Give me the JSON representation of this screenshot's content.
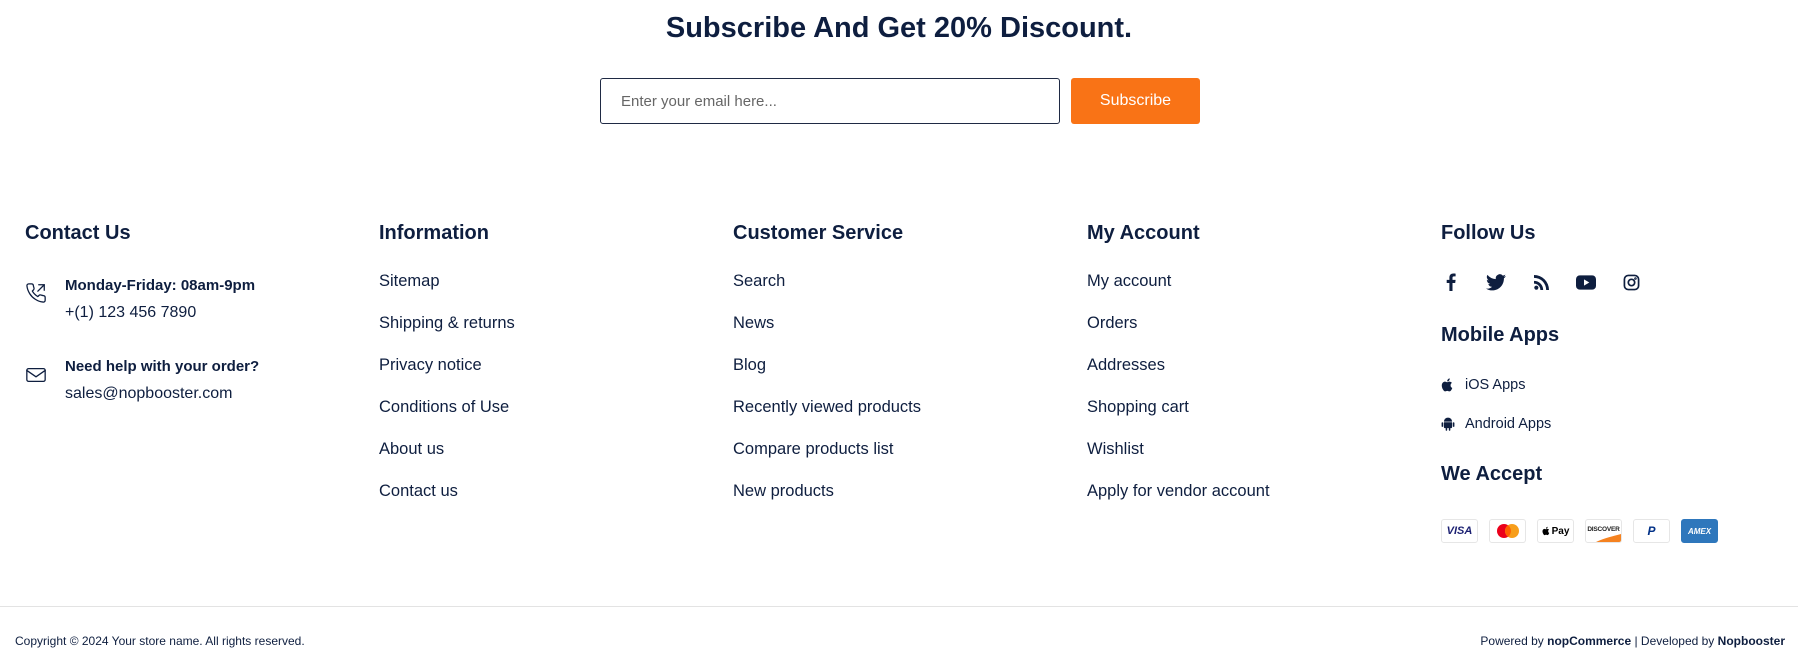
{
  "subscribe": {
    "title": "Subscribe And Get 20% Discount.",
    "placeholder": "Enter your email here...",
    "button_label": "Subscribe"
  },
  "contact": {
    "title": "Contact Us",
    "hours_label": "Monday-Friday: 08am-9pm",
    "phone": "+(1) 123 456 7890",
    "help_label": "Need help with your order?",
    "email": "sales@nopbooster.com"
  },
  "information": {
    "title": "Information",
    "links": [
      "Sitemap",
      "Shipping & returns",
      "Privacy notice",
      "Conditions of Use",
      "About us",
      "Contact us"
    ]
  },
  "customer_service": {
    "title": "Customer Service",
    "links": [
      "Search",
      "News",
      "Blog",
      "Recently viewed products",
      "Compare products list",
      "New products"
    ]
  },
  "my_account": {
    "title": "My Account",
    "links": [
      "My account",
      "Orders",
      "Addresses",
      "Shopping cart",
      "Wishlist",
      "Apply for vendor account"
    ]
  },
  "follow": {
    "title": "Follow Us",
    "icons": [
      "facebook-icon",
      "twitter-icon",
      "rss-icon",
      "youtube-icon",
      "instagram-icon"
    ],
    "mobile_title": "Mobile Apps",
    "ios_label": "iOS Apps",
    "android_label": "Android Apps",
    "accept_title": "We Accept",
    "cards": {
      "visa": "VISA",
      "applepay": "Pay",
      "discover": "DISCOVER",
      "paypal": "P",
      "amex": "AMEX"
    }
  },
  "footer": {
    "copyright": "Copyright © 2024 Your store name. All rights reserved.",
    "powered_prefix": "Powered by ",
    "powered_brand": "nopCommerce",
    "developed_prefix": " | Developed by ",
    "developed_brand": "Nopbooster"
  },
  "colors": {
    "accent": "#f97316",
    "text": "#0e1e3f",
    "amex": "#2e77bc",
    "visa": "#1a1f71"
  }
}
